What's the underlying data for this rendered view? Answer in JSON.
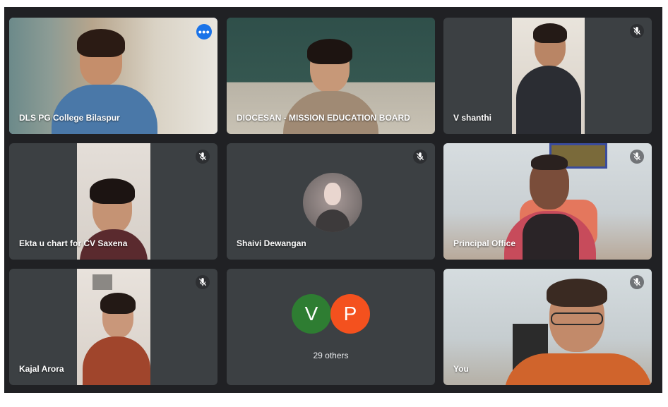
{
  "participants": [
    {
      "name": "DLS PG College Bilaspur"
    },
    {
      "name": "DIOCESAN - MISSION EDUCATION BOARD"
    },
    {
      "name": "V shanthi"
    },
    {
      "name": "Ekta u chart for CV Saxena"
    },
    {
      "name": "Shaivi Dewangan"
    },
    {
      "name": "Principal Office"
    },
    {
      "name": "Kajal Arora"
    },
    {
      "name": "You"
    }
  ],
  "others_tile": {
    "avatars": [
      {
        "letter": "V",
        "color": "#2e7d32"
      },
      {
        "letter": "P",
        "color": "#f4511e"
      }
    ],
    "label": "29 others"
  },
  "icons": {
    "mute": "mic-off-icon",
    "more": "more-options-icon"
  },
  "colors": {
    "background": "#202124",
    "tile": "#3c4043",
    "active_border": "#8ab4f8",
    "menu_button": "#1a73e8"
  }
}
